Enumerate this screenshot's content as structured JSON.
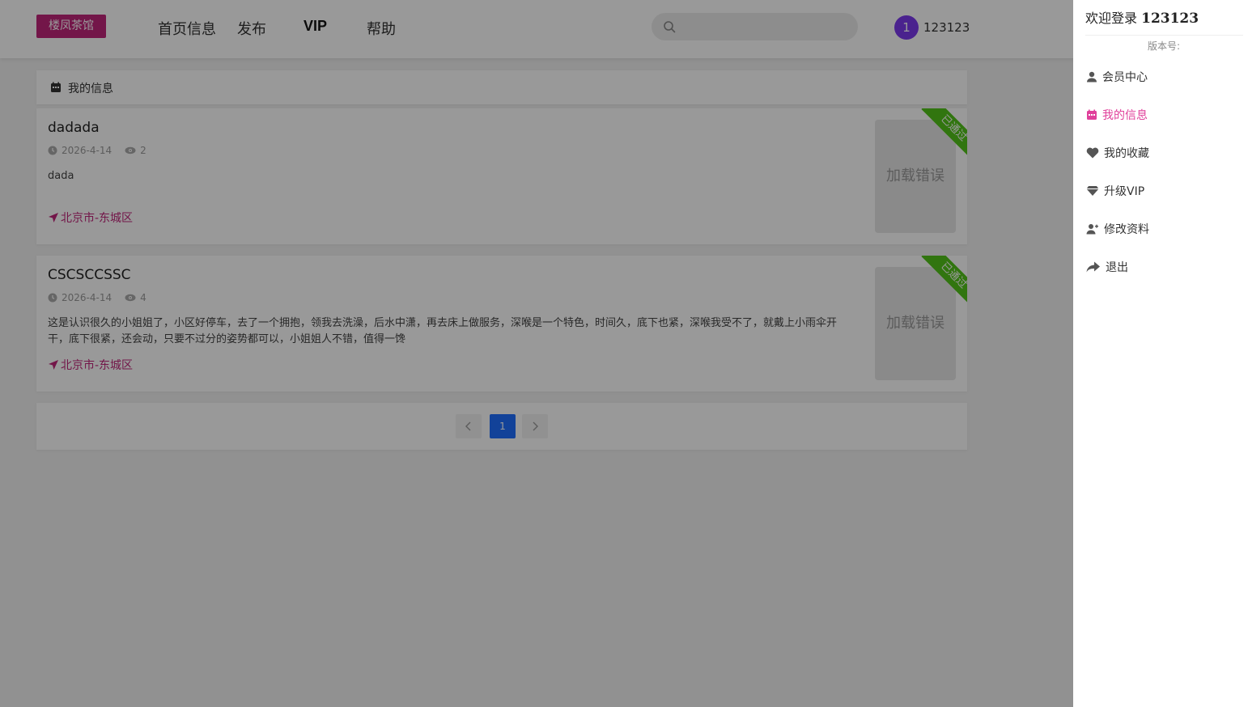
{
  "header": {
    "logo": "楼凤茶馆",
    "nav": [
      "首页信息",
      "发布",
      "VIP",
      "帮助"
    ],
    "search_placeholder": "",
    "avatar_badge": "1",
    "username": "123123"
  },
  "main": {
    "section_title": "我的信息",
    "posts": [
      {
        "title": "dadada",
        "date": "2026-4-14",
        "views": "2",
        "description": "dada",
        "location": "北京市-东城区",
        "status": "已通过",
        "thumb_text": "加载错误"
      },
      {
        "title": "CSCSCCSSC",
        "date": "2026-4-14",
        "views": "4",
        "description": "这是认识很久的小姐姐了，小区好停车，去了一个拥抱，领我去洗澡，后水中潇，再去床上做服务，深喉是一个特色，时间久，底下也紧，深喉我受不了，就戴上小雨伞开干，底下很紧，还会动，只要不过分的姿势都可以，小姐姐人不错，值得一馋",
        "location": "北京市-东城区",
        "status": "已通过",
        "thumb_text": "加载错误"
      }
    ],
    "pagination": {
      "current": "1"
    }
  },
  "drawer": {
    "welcome_prefix": "欢迎登录",
    "welcome_user": "123123",
    "version_label": "版本号:",
    "menu": [
      {
        "label": "会员中心",
        "icon": "user-icon"
      },
      {
        "label": "我的信息",
        "icon": "calendar-icon",
        "active": true
      },
      {
        "label": "我的收藏",
        "icon": "heart-icon"
      },
      {
        "label": "升级VIP",
        "icon": "diamond-icon"
      },
      {
        "label": "修改资料",
        "icon": "user-edit-icon"
      },
      {
        "label": "退出",
        "icon": "share-arrow-icon"
      }
    ]
  },
  "colors": {
    "brand": "#c0257a",
    "active_menu": "#e0409b",
    "status_ribbon": "#52c41a",
    "page_current": "#1e6fff",
    "avatar": "#7c3aed"
  }
}
